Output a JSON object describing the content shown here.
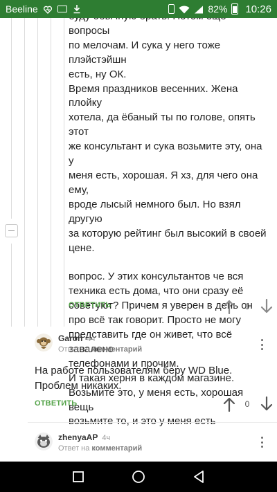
{
  "status_bar": {
    "carrier": "Beeline",
    "battery_percent": "82%",
    "battery_level": 0.82,
    "time": "10:26",
    "icons": [
      "heart-icon",
      "mail-icon",
      "vibrate-icon",
      "wifi-icon",
      "signal-icon",
      "battery-icon"
    ]
  },
  "comment1": {
    "paragraph1": "буду обычную брать. Потом еще вопросы\nпо мелочам. И сука у него тоже плэйстэйшн\nесть, ну ОК.\nВремя праздников весенних. Жена плойку\nхотела, да ёбаный ты по голове, опять этот\nже консультант и сука возьмите эту, она у\nменя есть, хорошая. Я хз, для чего она ему,\nвроде лысый немного был. Но взял другую\nза которую рейтинг был высокий в своей\nцене.",
    "paragraph2": "вопрос. У этих консультантов че вся\nтехника есть дома, что они сразу её\nсоветуют? Причем я уверен в день он\nпро всё так говорит. Просто не могу\nпредставить где он живет, что всё завалено\nтелефонами и прочим.\nИ такая херня в каждом магазине.\nВозьмите это, у меня есть, хорошая вещь\nвозьмите то, и это у меня есть",
    "reply_label": "ОТВЕТИТЬ",
    "rating": "0"
  },
  "comment2": {
    "username": "Garon",
    "age": "4ч",
    "reply_prefix": "Ответ на",
    "reply_target": "комментарий",
    "text": "На работе пользователям беру WD Blue. Проблем никаких.",
    "reply_label": "ОТВЕТИТЬ",
    "rating": "0"
  },
  "comment3": {
    "username": "zhenyaAP",
    "age": "4ч",
    "reply_prefix": "Ответ на",
    "reply_target": "комментарий"
  },
  "colors": {
    "status_bar": "#2e7d32",
    "accent_green": "#56a44b",
    "nav_bar": "#000000"
  }
}
